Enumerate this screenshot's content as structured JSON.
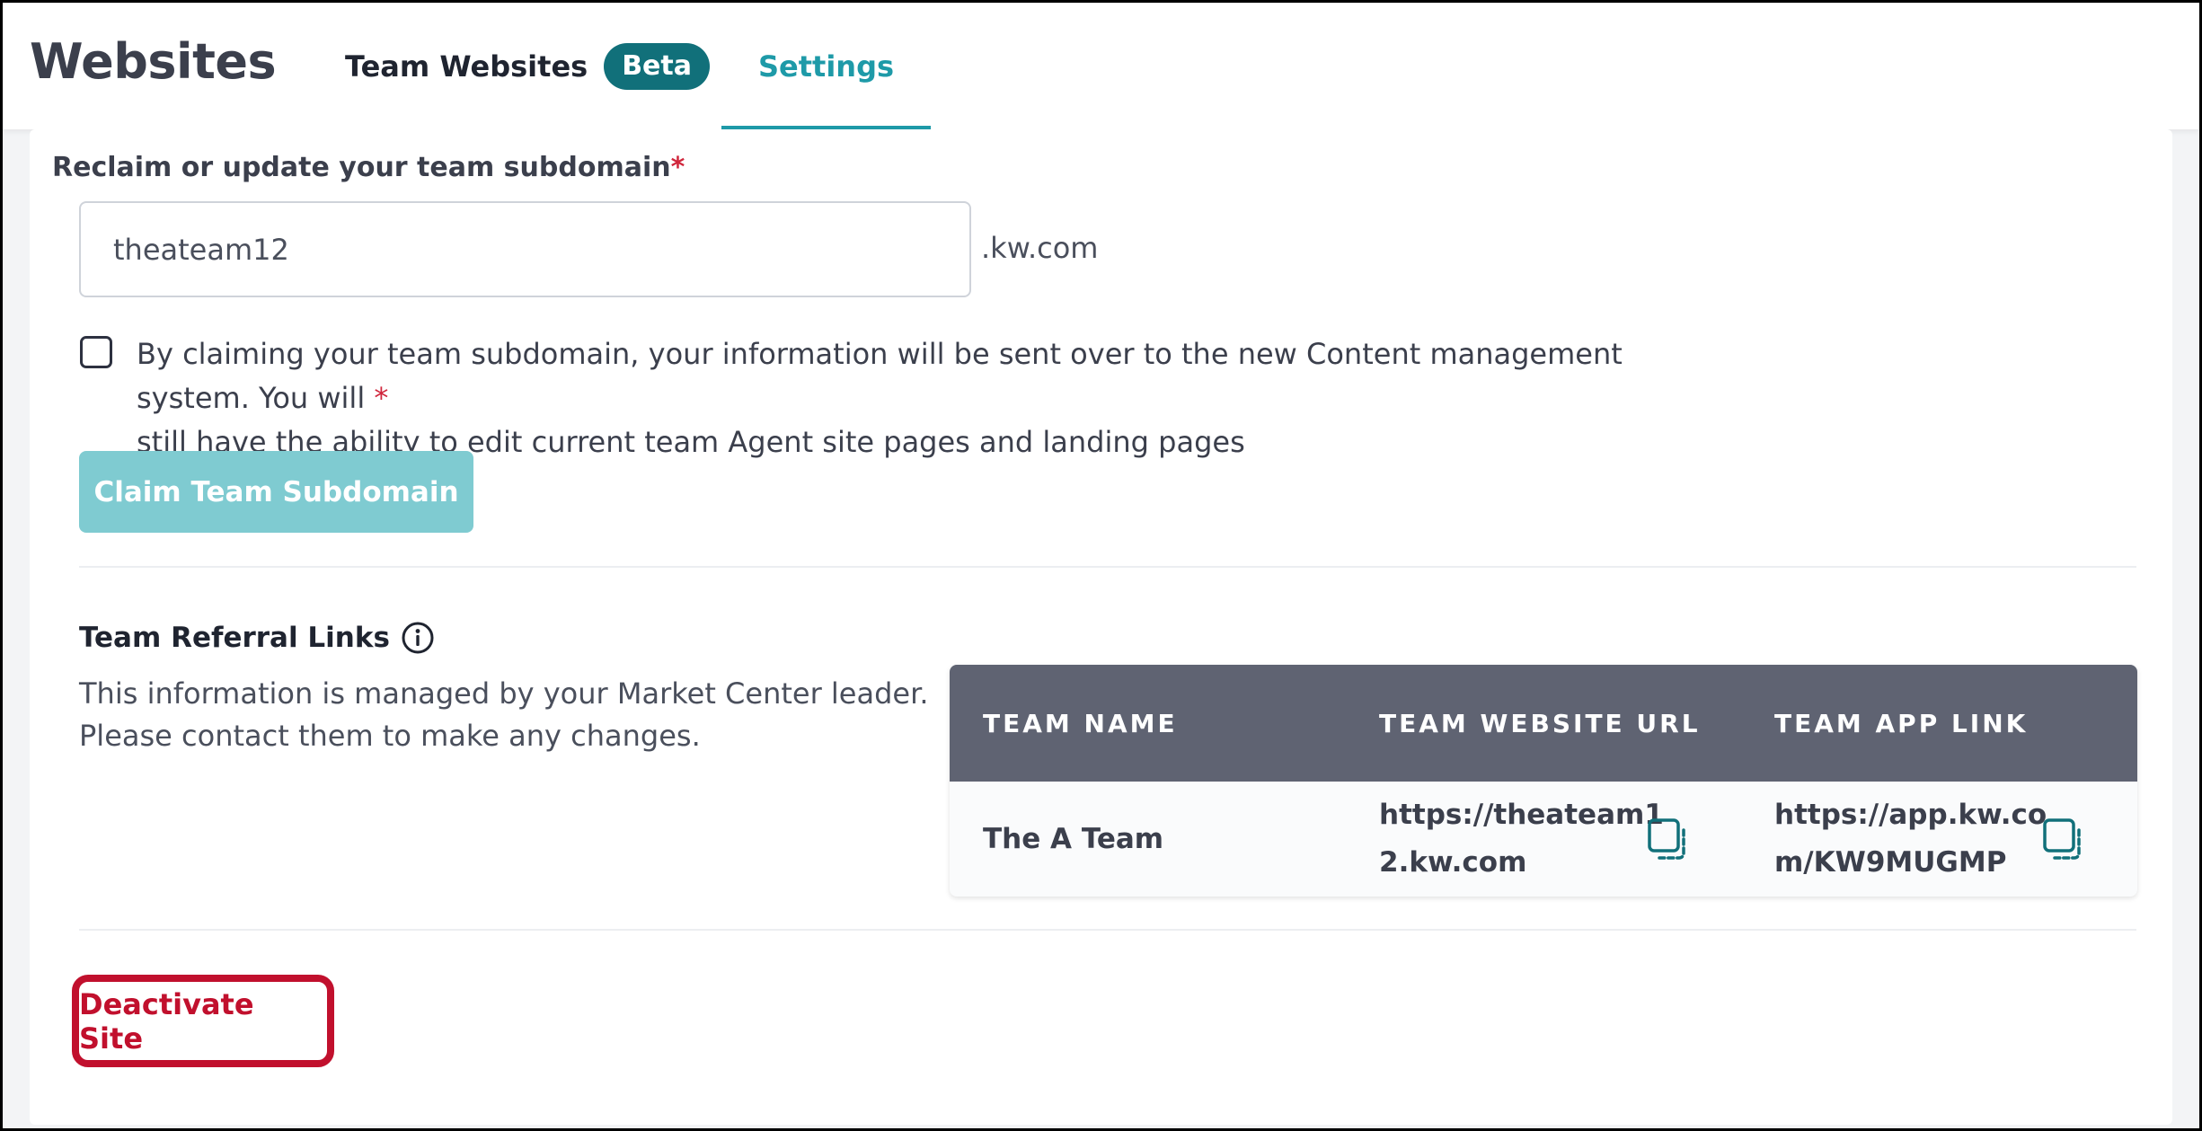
{
  "header": {
    "app_title": "Websites",
    "tabs": [
      {
        "label": "Team Websites",
        "badge": "Beta"
      },
      {
        "label": "Settings",
        "active": true
      }
    ]
  },
  "subdomain": {
    "label": "Reclaim or update your team subdomain",
    "required_mark": "*",
    "value": "theateam12",
    "suffix": ".kw.com"
  },
  "consent": {
    "text_line1": "By claiming your team subdomain, your information will be sent over to the new Content management system. You will",
    "required_mark": "*",
    "text_line2": "still have the ability to edit current team Agent site pages and landing pages",
    "checked": false
  },
  "claim_button": {
    "label": "Claim Team Subdomain"
  },
  "referral": {
    "title": "Team Referral Links",
    "note_line1": "This information is managed by your Market Center leader.",
    "note_line2": "Please contact them to make any changes.",
    "table": {
      "headers": [
        "TEAM NAME",
        "TEAM WEBSITE URL",
        "TEAM APP LINK"
      ],
      "row": {
        "team_name": "The A Team",
        "website_url_line1": "https://theateam1",
        "website_url_line2": "2.kw.com",
        "app_link_line1": "https://app.kw.co",
        "app_link_line2": "m/KW9MUGMP"
      }
    }
  },
  "deactivate_button": {
    "label": "Deactivate Site"
  },
  "colors": {
    "accent": "#1e9aa8",
    "beta_badge": "#11707a",
    "claim_button_disabled": "#7fcbd1",
    "table_header": "#5f6372",
    "danger": "#c1102d",
    "required": "#d0263c"
  },
  "icons": {
    "info": "info-circle-icon",
    "copy": "copy-icon"
  }
}
